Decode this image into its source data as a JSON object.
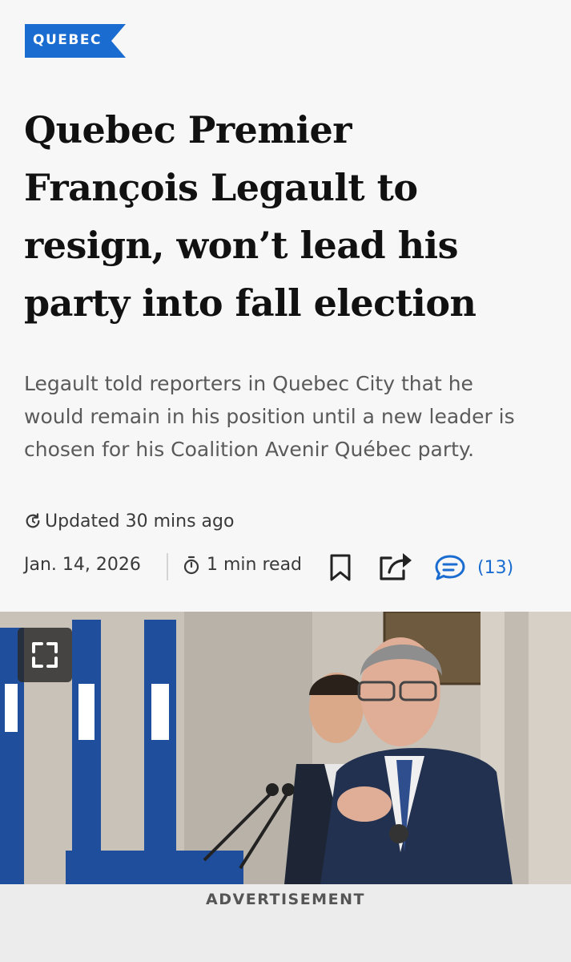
{
  "article": {
    "section": "QUEBEC",
    "headline_lines": [
      "Quebec Premier",
      "François Legault to",
      "resign, won’t lead his",
      "party into fall election"
    ],
    "dek_lines": [
      "Legault told reporters in Quebec City that he",
      "would remain in his position until a new leader is",
      "chosen for his Coalition Avenir Québec party."
    ],
    "updated": "Updated 30 mins ago",
    "date": "Jan. 14, 2026",
    "read_time": "1 min read",
    "comments_count": "(13)"
  },
  "photo": {
    "expand_icon": "expand-icon"
  },
  "ad": {
    "label": "ADVERTISEMENT"
  },
  "colors": {
    "accent": "#1a6cd0",
    "section_tag": "#1a6cd0",
    "flag_blue": "#1f4e9c"
  }
}
